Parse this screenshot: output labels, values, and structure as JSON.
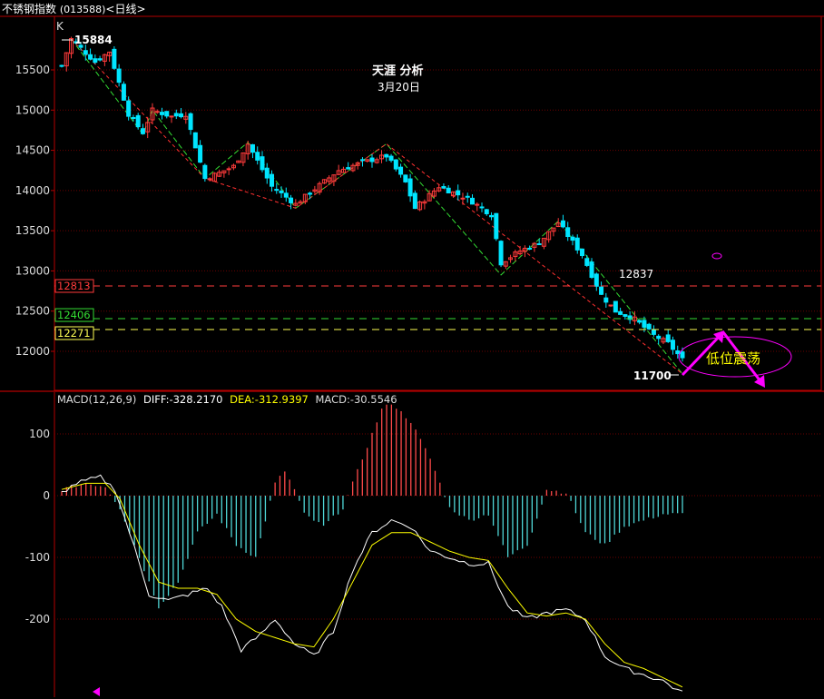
{
  "window": {
    "title": "不锈钢指数",
    "code": "(013588)",
    "period": "<日线>",
    "corner_label": "K"
  },
  "colors": {
    "background": "#000000",
    "frame": "#b30000",
    "grid": "#6a0000",
    "up": "#ff3b3b",
    "down": "#00e5ff",
    "diff": "#ffffff",
    "dea": "#ffff00",
    "macd_pos": "#ff4a4a",
    "macd_neg": "#4fd6d6",
    "annotation": "#ff00ff",
    "wave_down": "#ff3030",
    "wave_up": "#33dd33"
  },
  "annotation": {
    "author": "天涯 分析",
    "date": "3月20日",
    "label": "低位震荡"
  },
  "price_labels": {
    "high": "15884",
    "low": "11700",
    "mid": "12837"
  },
  "levels": [
    {
      "label": "12813",
      "value": 12813,
      "color": "#ff3b3b"
    },
    {
      "label": "12406",
      "value": 12406,
      "color": "#33dd33"
    },
    {
      "label": "12271",
      "value": 12271,
      "color": "#ffff55"
    }
  ],
  "macd_header": {
    "name": "MACD(12,26,9)",
    "diff": "DIFF:-328.2170",
    "dea": "DEA:-312.9397",
    "macd": "MACD:-30.5546"
  },
  "chart_data": [
    {
      "type": "candlestick",
      "title": "不锈钢指数 (013588)<日线>",
      "ylim": [
        11600,
        16000
      ],
      "yticks": [
        "12000",
        "12500",
        "13000",
        "13500",
        "14000",
        "14500",
        "15000",
        "15500"
      ],
      "grid": true,
      "waypoints": [
        [
          0,
          15550
        ],
        [
          2,
          15884
        ],
        [
          7,
          15600
        ],
        [
          10,
          15730
        ],
        [
          14,
          14950
        ],
        [
          17,
          14720
        ],
        [
          19,
          15000
        ],
        [
          23,
          14920
        ],
        [
          26,
          14950
        ],
        [
          30,
          14150
        ],
        [
          33,
          14220
        ],
        [
          36,
          14300
        ],
        [
          39,
          14580
        ],
        [
          44,
          14050
        ],
        [
          49,
          13830
        ],
        [
          53,
          14020
        ],
        [
          58,
          14250
        ],
        [
          63,
          14350
        ],
        [
          68,
          14430
        ],
        [
          72,
          14100
        ],
        [
          74,
          13780
        ],
        [
          79,
          14050
        ],
        [
          85,
          13900
        ],
        [
          90,
          13700
        ],
        [
          92,
          13100
        ],
        [
          96,
          13250
        ],
        [
          100,
          13350
        ],
        [
          104,
          13600
        ],
        [
          109,
          13200
        ],
        [
          113,
          12700
        ],
        [
          116,
          12500
        ],
        [
          120,
          12400
        ],
        [
          124,
          12200
        ],
        [
          127,
          12100
        ],
        [
          130,
          11900
        ]
      ],
      "price_labels": [
        "15884",
        "11700",
        "12837"
      ],
      "levels": [
        12813,
        12406,
        12271
      ]
    },
    {
      "type": "bar+line",
      "title": "MACD(12,26,9)",
      "ylim": [
        -320,
        150
      ],
      "yticks": [
        "100",
        "0",
        "-100",
        "-200"
      ],
      "series": [
        {
          "name": "DIFF",
          "values_waypoints": [
            [
              0,
              5
            ],
            [
              3,
              20
            ],
            [
              8,
              30
            ],
            [
              11,
              10
            ],
            [
              14,
              -60
            ],
            [
              18,
              -160
            ],
            [
              22,
              -170
            ],
            [
              26,
              -160
            ],
            [
              30,
              -150
            ],
            [
              33,
              -180
            ],
            [
              37,
              -250
            ],
            [
              41,
              -225
            ],
            [
              44,
              -200
            ],
            [
              48,
              -240
            ],
            [
              52,
              -260
            ],
            [
              56,
              -220
            ],
            [
              60,
              -120
            ],
            [
              64,
              -60
            ],
            [
              68,
              -40
            ],
            [
              72,
              -50
            ],
            [
              76,
              -90
            ],
            [
              80,
              -100
            ],
            [
              84,
              -110
            ],
            [
              88,
              -110
            ],
            [
              92,
              -180
            ],
            [
              96,
              -200
            ],
            [
              100,
              -190
            ],
            [
              104,
              -185
            ],
            [
              108,
              -200
            ],
            [
              112,
              -260
            ],
            [
              116,
              -280
            ],
            [
              120,
              -290
            ],
            [
              124,
              -300
            ],
            [
              128,
              -320
            ]
          ]
        },
        {
          "name": "DEA",
          "values_waypoints": [
            [
              0,
              10
            ],
            [
              5,
              20
            ],
            [
              9,
              20
            ],
            [
              12,
              -5
            ],
            [
              16,
              -80
            ],
            [
              20,
              -140
            ],
            [
              24,
              -150
            ],
            [
              28,
              -150
            ],
            [
              32,
              -160
            ],
            [
              36,
              -200
            ],
            [
              40,
              -220
            ],
            [
              44,
              -230
            ],
            [
              48,
              -240
            ],
            [
              52,
              -245
            ],
            [
              56,
              -200
            ],
            [
              60,
              -140
            ],
            [
              64,
              -80
            ],
            [
              68,
              -60
            ],
            [
              72,
              -60
            ],
            [
              76,
              -75
            ],
            [
              80,
              -90
            ],
            [
              84,
              -100
            ],
            [
              88,
              -105
            ],
            [
              92,
              -150
            ],
            [
              96,
              -190
            ],
            [
              100,
              -195
            ],
            [
              104,
              -190
            ],
            [
              108,
              -200
            ],
            [
              112,
              -240
            ],
            [
              116,
              -270
            ],
            [
              120,
              -280
            ],
            [
              124,
              -295
            ],
            [
              128,
              -310
            ]
          ]
        },
        {
          "name": "MACD",
          "values_waypoints": [
            [
              0,
              10
            ],
            [
              5,
              20
            ],
            [
              9,
              15
            ],
            [
              12,
              -20
            ],
            [
              16,
              -100
            ],
            [
              20,
              -180
            ],
            [
              24,
              -140
            ],
            [
              28,
              -60
            ],
            [
              32,
              -30
            ],
            [
              36,
              -80
            ],
            [
              40,
              -100
            ],
            [
              42,
              -40
            ],
            [
              44,
              20
            ],
            [
              46,
              40
            ],
            [
              48,
              10
            ],
            [
              50,
              -30
            ],
            [
              54,
              -50
            ],
            [
              58,
              -20
            ],
            [
              62,
              60
            ],
            [
              66,
              140
            ],
            [
              68,
              150
            ],
            [
              72,
              120
            ],
            [
              76,
              60
            ],
            [
              80,
              -20
            ],
            [
              84,
              -40
            ],
            [
              88,
              -30
            ],
            [
              92,
              -100
            ],
            [
              96,
              -80
            ],
            [
              100,
              10
            ],
            [
              104,
              5
            ],
            [
              108,
              -60
            ],
            [
              112,
              -80
            ],
            [
              116,
              -50
            ],
            [
              120,
              -40
            ],
            [
              124,
              -30
            ],
            [
              128,
              -30
            ]
          ]
        }
      ]
    }
  ]
}
